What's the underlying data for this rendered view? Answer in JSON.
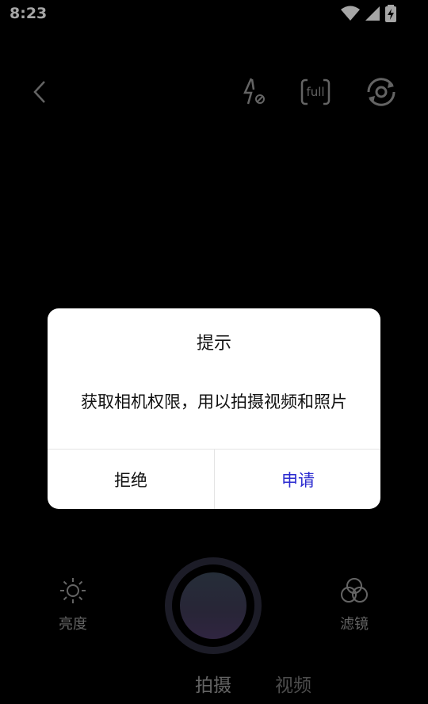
{
  "status_bar": {
    "time": "8:23"
  },
  "top_bar": {
    "back_icon": "back-chevron-icon",
    "flash_icon": "flash-off-icon",
    "ratio_label": "full",
    "switch_icon": "camera-switch-icon"
  },
  "dialog": {
    "title": "提示",
    "message": "获取相机权限，用以拍摄视频和照片",
    "deny_label": "拒绝",
    "apply_label": "申请",
    "apply_color": "#2a2ad0"
  },
  "bottom": {
    "brightness_label": "亮度",
    "filter_label": "滤镜",
    "modes": [
      "拍摄",
      "视频"
    ]
  }
}
